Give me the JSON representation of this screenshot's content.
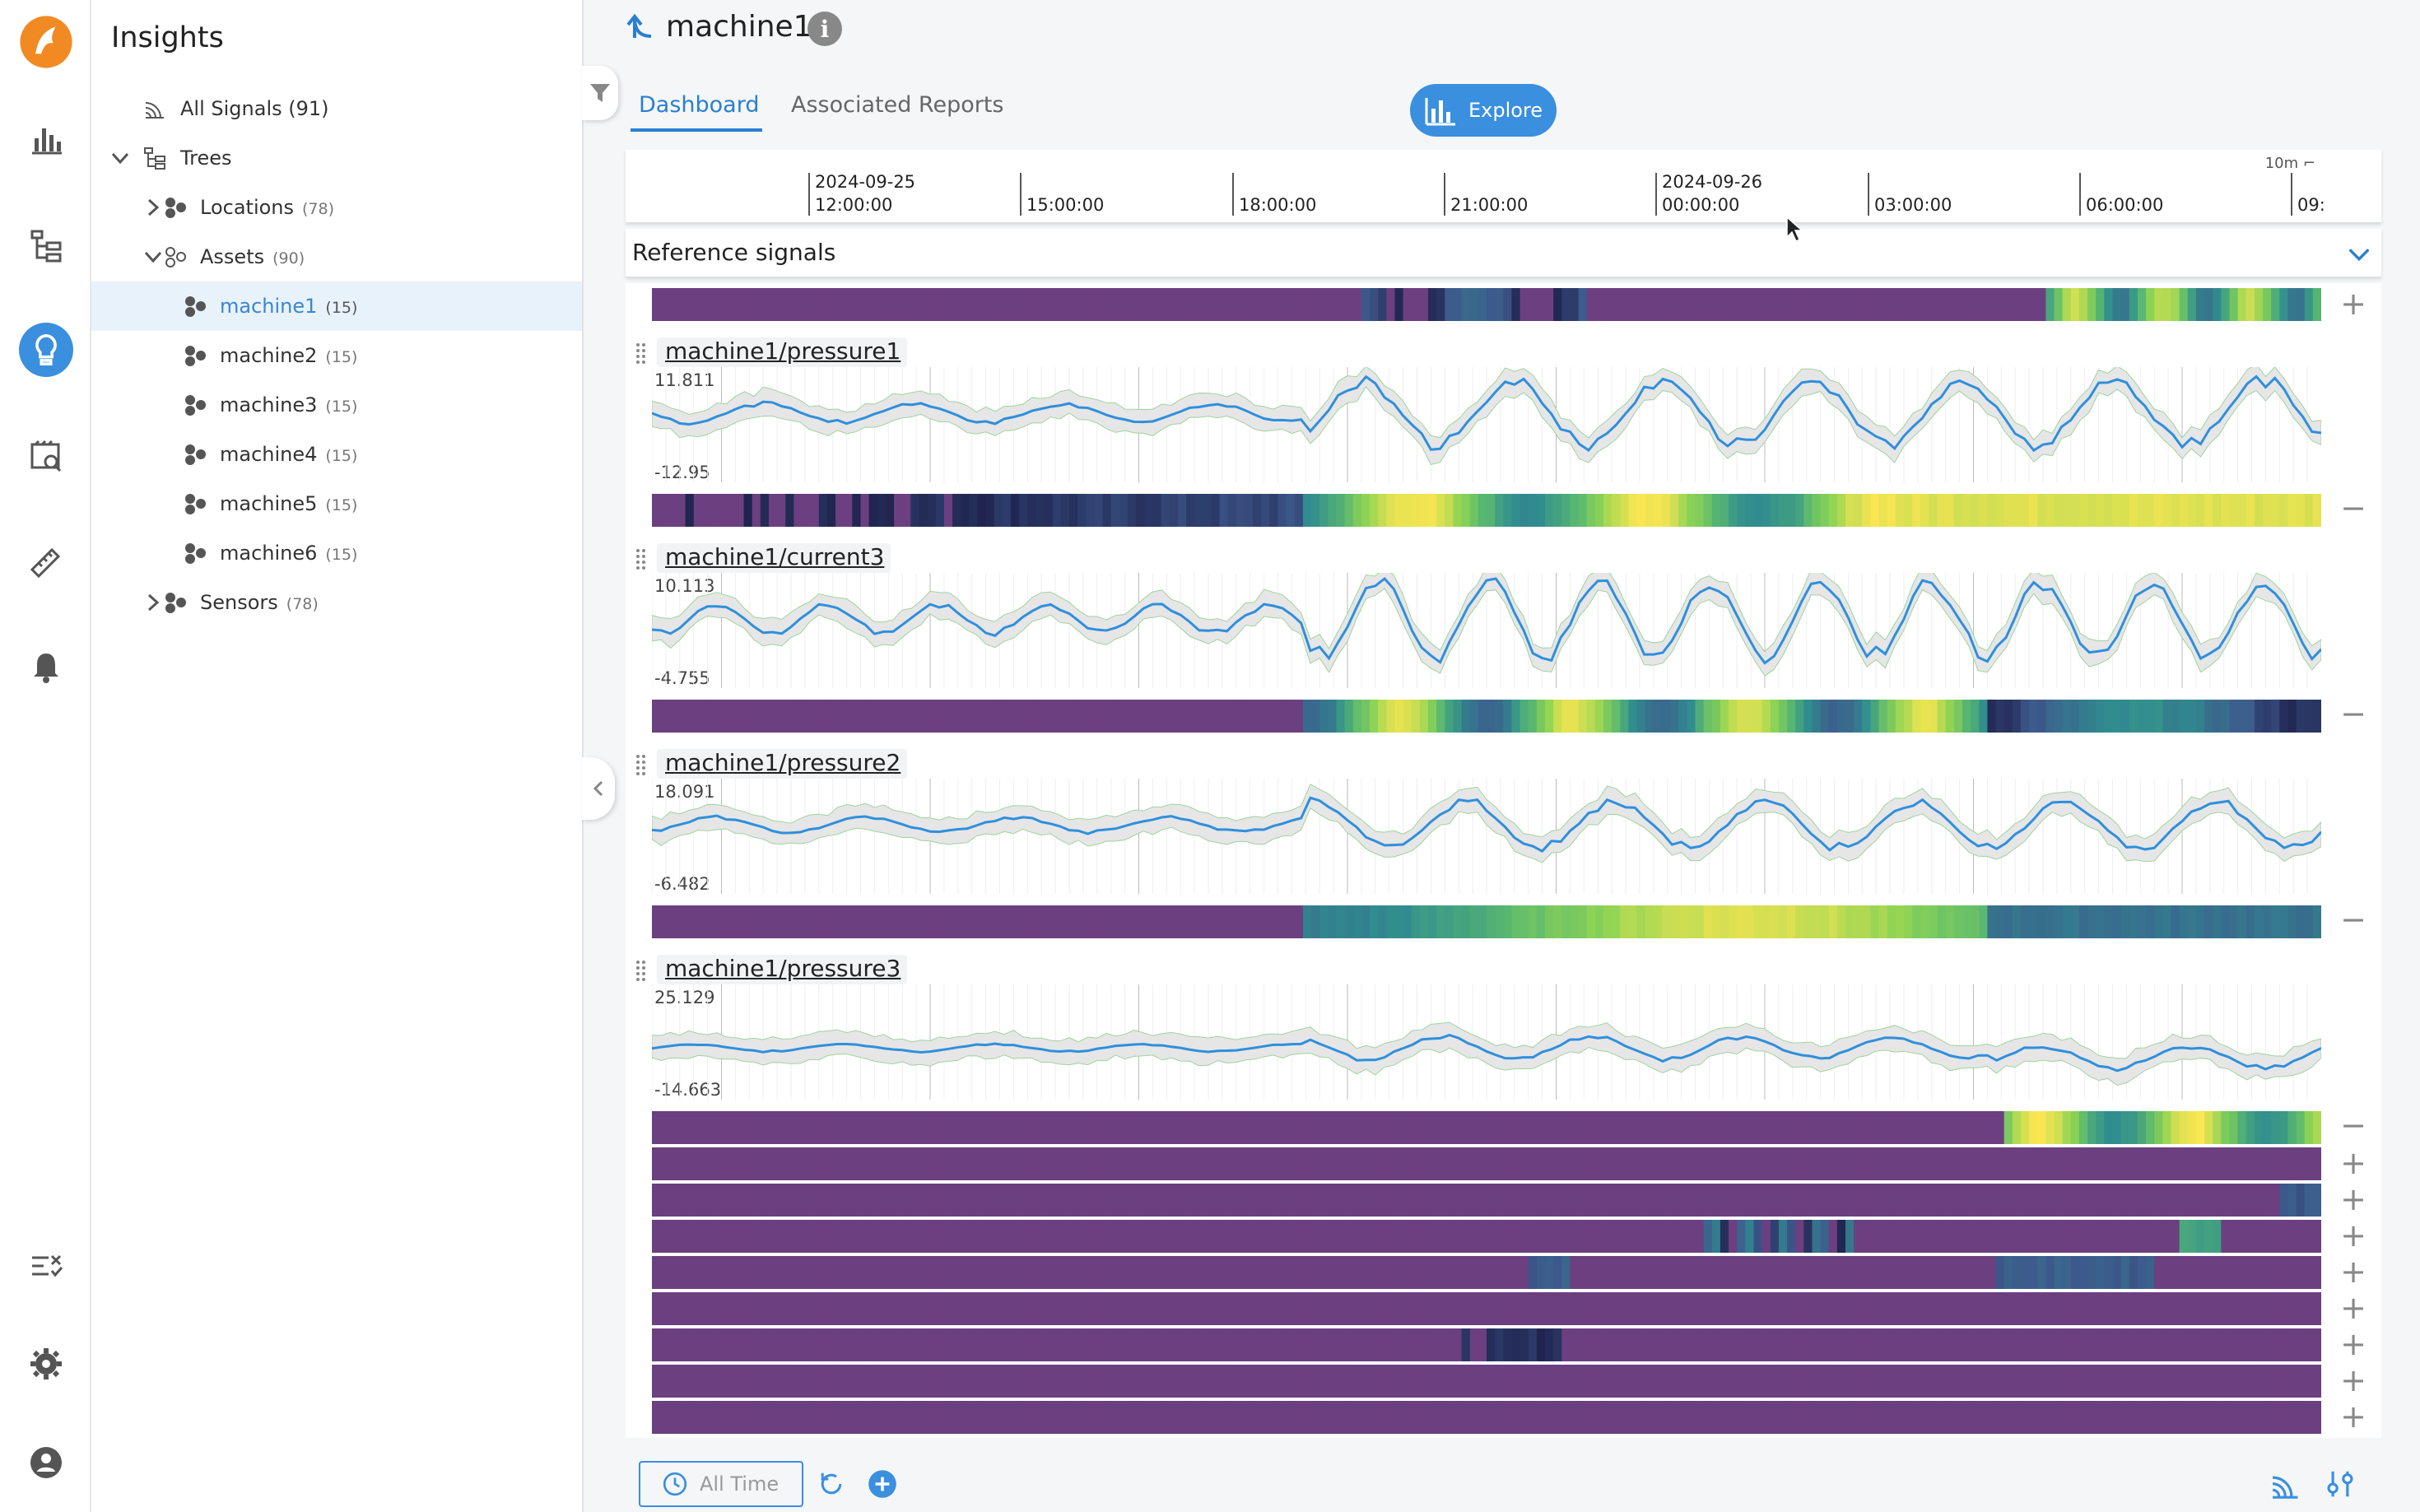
{
  "sidebar": {
    "title": "Insights",
    "items": [
      {
        "label": "All Signals (91)",
        "count": ""
      },
      {
        "label": "Trees",
        "count": ""
      },
      {
        "label": "Locations",
        "count": "(78)"
      },
      {
        "label": "Assets",
        "count": "(90)"
      },
      {
        "label": "machine1",
        "count": "(15)"
      },
      {
        "label": "machine2",
        "count": "(15)"
      },
      {
        "label": "machine3",
        "count": "(15)"
      },
      {
        "label": "machine4",
        "count": "(15)"
      },
      {
        "label": "machine5",
        "count": "(15)"
      },
      {
        "label": "machine6",
        "count": "(15)"
      },
      {
        "label": "Sensors",
        "count": "(78)"
      }
    ]
  },
  "header": {
    "title": "machine1",
    "tabs": [
      "Dashboard",
      "Associated Reports"
    ],
    "explore_label": "Explore"
  },
  "timeline": {
    "zoom": "10m",
    "ticks": [
      {
        "date": "2024-09-25",
        "time": "12:00:00"
      },
      {
        "date": "",
        "time": "15:00:00"
      },
      {
        "date": "",
        "time": "18:00:00"
      },
      {
        "date": "",
        "time": "21:00:00"
      },
      {
        "date": "2024-09-26",
        "time": "00:00:00"
      },
      {
        "date": "",
        "time": "03:00:00"
      },
      {
        "date": "",
        "time": "06:00:00"
      },
      {
        "date": "",
        "time": "09:"
      }
    ]
  },
  "reference": {
    "title": "Reference signals"
  },
  "signals": [
    {
      "name": "machine1/pressure1",
      "ymax": "11.811",
      "ymin": "-12.95"
    },
    {
      "name": "machine1/current3",
      "ymax": "10.113",
      "ymin": "-4.755"
    },
    {
      "name": "machine1/pressure2",
      "ymax": "18.091",
      "ymin": "-6.482"
    },
    {
      "name": "machine1/pressure3",
      "ymax": "25.129",
      "ymin": "-14.663"
    }
  ],
  "bottom": {
    "time_range": "All Time"
  },
  "colors": {
    "accent": "#3a8fde",
    "purple": "#6a3d7f",
    "yellow": "#f6e451",
    "teal": "#3d9d94",
    "green": "#8fd36a"
  }
}
